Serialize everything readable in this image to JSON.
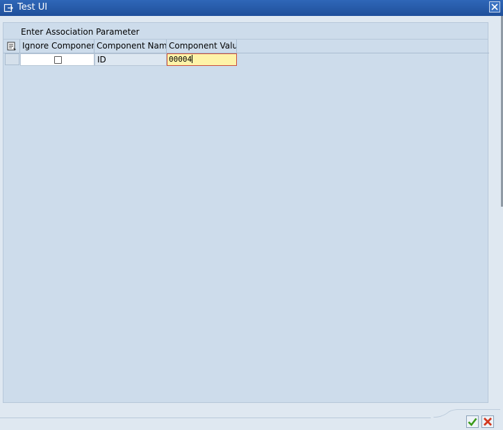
{
  "window": {
    "title": "Test UI"
  },
  "panel": {
    "title": "Enter Association Parameter"
  },
  "table": {
    "columns": [
      "Ignore Component",
      "Component Name",
      "Component Value"
    ],
    "rows": [
      {
        "ignore_component": false,
        "component_name": "ID",
        "component_value": "00004"
      }
    ]
  },
  "colors": {
    "titlebar": "#1f4f9a",
    "panel_bg": "#cddceb",
    "value_field_bg": "#fef3a8",
    "confirm_green": "#3a9a1a",
    "cancel_red": "#d2381f"
  },
  "icons": {
    "window": "window-icon",
    "close": "close-icon",
    "table_settings": "table-settings-icon",
    "confirm": "checkmark-icon",
    "cancel": "cancel-x-icon"
  }
}
